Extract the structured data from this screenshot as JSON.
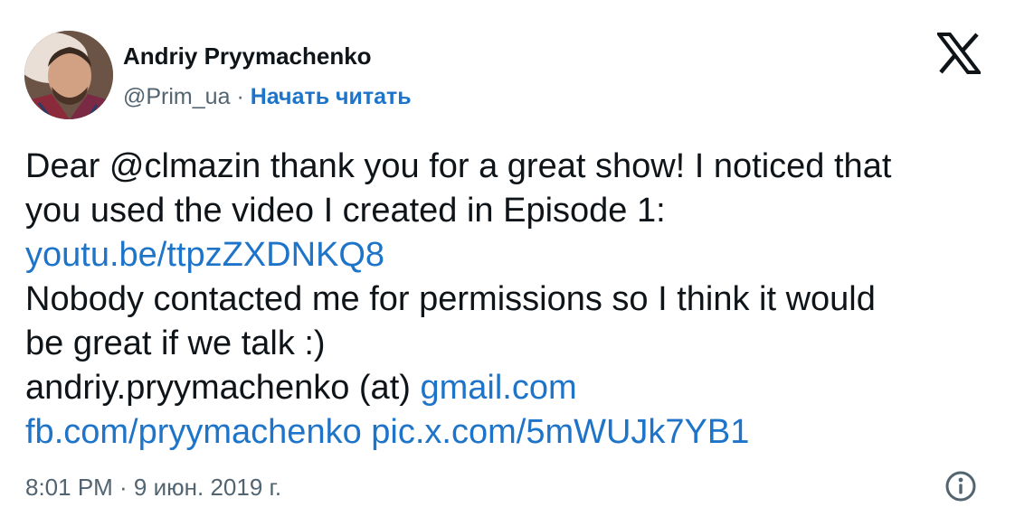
{
  "author": {
    "name": "Andriy Pryymachenko",
    "handle": "@Prim_ua",
    "separator": "·",
    "follow_label": "Начать читать"
  },
  "icons": {
    "brand": "x-logo-icon",
    "info": "info-icon"
  },
  "tweet": {
    "line1": "Dear @clmazin thank you for a great show! I noticed that",
    "line2": "you used the video I created in Episode 1:",
    "link_youtube": "youtu.be/ttpzZXDNKQ8",
    "line4": "Nobody contacted me for permissions so I think it would",
    "line5": "be great if we talk :)",
    "email_prefix": "andriy.pryymachenko (at)",
    "link_gmail": "gmail.com",
    "link_fb": "fb.com/pryymachenko",
    "link_pic": "pic.x.com/5mWUJk7YB1"
  },
  "meta": {
    "timestamp": "8:01 PM · 9 июн. 2019 г."
  },
  "colors": {
    "link": "#1d74c9",
    "text": "#0f1419",
    "muted": "#536471"
  }
}
